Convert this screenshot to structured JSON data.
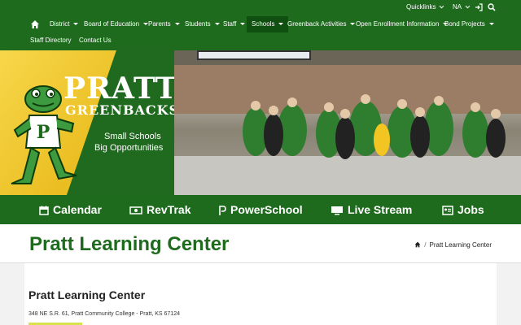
{
  "utility": {
    "quicklinks_label": "Quicklinks",
    "language_label": "NA"
  },
  "nav": {
    "items": [
      {
        "label": "District"
      },
      {
        "label": "Board of Education"
      },
      {
        "label": "Parents"
      },
      {
        "label": "Students"
      },
      {
        "label": "Staff"
      },
      {
        "label": "Schools"
      },
      {
        "label": "Greenback Activities"
      },
      {
        "label": "Open Enrollment Information"
      },
      {
        "label": "Bond Projects"
      },
      {
        "label": "Staff Directory"
      },
      {
        "label": "Contact Us"
      }
    ]
  },
  "hero": {
    "brand_line1": "PRATT",
    "brand_line2": "GREENBACKS",
    "tagline1": "Small Schools",
    "tagline2": "Big Opportunities",
    "mascot_letter": "P",
    "slide_count": 10,
    "active_slide": 1
  },
  "quick_links": [
    {
      "label": "Calendar",
      "icon": "calendar-icon"
    },
    {
      "label": "RevTrak",
      "icon": "money-icon"
    },
    {
      "label": "PowerSchool",
      "icon": "powerschool-icon"
    },
    {
      "label": "Live Stream",
      "icon": "monitor-icon"
    },
    {
      "label": "Jobs",
      "icon": "id-card-icon"
    }
  ],
  "page": {
    "title": "Pratt Learning Center",
    "breadcrumb_current": "Pratt Learning Center",
    "heading": "Pratt Learning Center",
    "address": "348 NE S.R. 61, Pratt Community College - Pratt, KS 67124"
  },
  "colors": {
    "primary_green": "#1e6b1e",
    "gold": "#f2c522",
    "accent_lime": "#d8e24a"
  }
}
